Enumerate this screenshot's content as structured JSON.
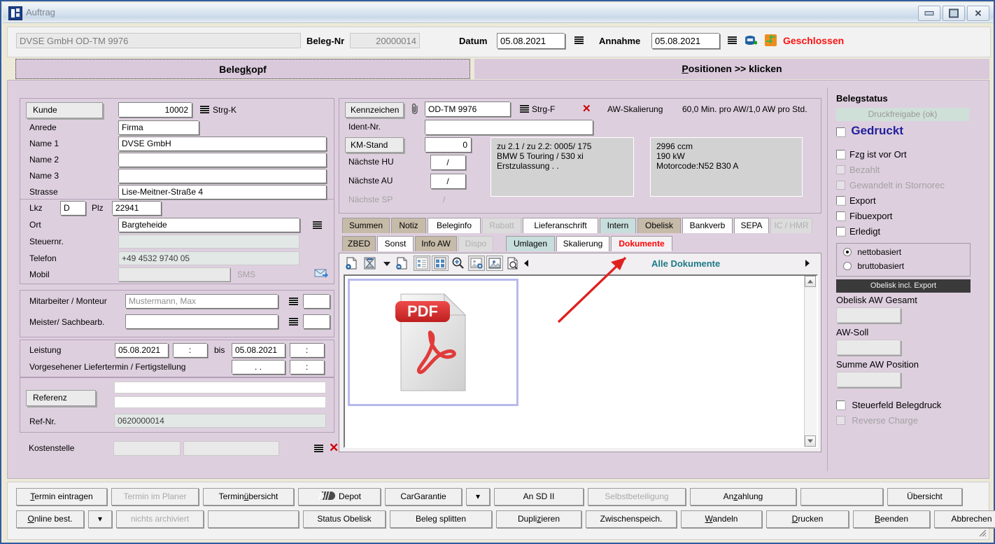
{
  "window": {
    "title": "Auftrag",
    "minimize": "–",
    "maximize": "□",
    "close": "✕"
  },
  "header": {
    "customer_vehicle": "DVSE GmbH OD-TM 9976",
    "beleg_nr_label": "Beleg-Nr",
    "beleg_nr_value": "20000014",
    "datum_label": "Datum",
    "datum_value": "05.08.2021",
    "annahme_label": "Annahme",
    "annahme_value": "05.08.2021",
    "status_text": "Geschlossen",
    "status_color": "#ff1111"
  },
  "main_tabs": [
    {
      "label": "Belegkopf",
      "accel": "k",
      "selected": true
    },
    {
      "label": "Positionen >> klicken",
      "accel": "P",
      "selected": false
    }
  ],
  "customer": {
    "kunde_label": "Kunde",
    "kunde_value": "10002",
    "kunde_shortcut": "Strg-K",
    "rows": [
      {
        "label": "Anrede",
        "value": "Firma"
      },
      {
        "label": "Name 1",
        "value": "DVSE GmbH"
      },
      {
        "label": "Name 2",
        "value": ""
      },
      {
        "label": "Name 3",
        "value": ""
      },
      {
        "label": "Strasse",
        "value": "Lise-Meitner-Straße 4"
      }
    ],
    "lkz_label": "Lkz",
    "lkz_value": "D",
    "plz_label": "Plz",
    "plz_value": "22941",
    "ort_label": "Ort",
    "ort_value": "Bargteheide",
    "steuernr_label": "Steuernr.",
    "steuernr_value": "",
    "telefon_label": "Telefon",
    "telefon_value": "+49 4532 9740 05",
    "mobil_label": "Mobil",
    "mobil_value": "",
    "sms_label": "SMS"
  },
  "staff": {
    "mitarbeiter_label": "Mitarbeiter / Monteur",
    "mitarbeiter_value": "Mustermann, Max",
    "meister_label": "Meister/ Sachbearb.",
    "meister_value": ""
  },
  "service": {
    "leistung_label": "Leistung",
    "leistung_from": "05.08.2021",
    "leistung_from_time": ":",
    "bis_label": "bis",
    "leistung_to": "05.08.2021",
    "leistung_to_time": ":",
    "liefertermin_label": "Vorgesehener Liefertermin / Fertigstellung",
    "liefertermin_date": ". .",
    "liefertermin_time": ":"
  },
  "reference": {
    "referenz_label": "Referenz",
    "referenz_line1": "",
    "referenz_line2": "",
    "refnr_label": "Ref-Nr.",
    "refnr_value": "0620000014"
  },
  "cost_center": {
    "label": "Kostenstelle",
    "value1": "",
    "value2": ""
  },
  "vehicle": {
    "kennzeichen_label": "Kennzeichen",
    "kennzeichen_value": "OD-TM 9976",
    "kennzeichen_shortcut": "Strg-F",
    "aw_skalierung_label": "AW-Skalierung",
    "aw_skalierung_value": "60,0 Min. pro AW/1,0 AW pro Std.",
    "ident_label": "Ident-Nr.",
    "ident_value": "",
    "km_label": "KM-Stand",
    "km_value": "0",
    "hu_label": "Nächste HU",
    "hu_value": "/",
    "au_label": "Nächste AU",
    "au_value": "/",
    "sp_label": "Nächste SP",
    "sp_value": "/",
    "info_left": [
      "zu 2.1 / zu 2.2: 0005/ 175",
      "BMW 5 Touring / 530 xi",
      "Erstzulassung  . ."
    ],
    "info_right": [
      "2996 ccm",
      "190 kW",
      "Motorcode:N52 B30 A"
    ]
  },
  "sub_tabs_row1": [
    {
      "label": "Summen",
      "style": "b"
    },
    {
      "label": "Notiz",
      "style": "b"
    },
    {
      "label": "Beleginfo",
      "style": "w"
    },
    {
      "label": "Rabatt",
      "style": "d"
    },
    {
      "label": "Lieferanschrift",
      "style": "w"
    },
    {
      "label": "Intern",
      "style": "t"
    },
    {
      "label": "Obelisk",
      "style": "b"
    },
    {
      "label": "Bankverb",
      "style": "w"
    },
    {
      "label": "SEPA",
      "style": "w"
    },
    {
      "label": "IC / HMR",
      "style": "d"
    }
  ],
  "sub_tabs_row2": [
    {
      "label": "ZBED",
      "style": "b"
    },
    {
      "label": "Sonst",
      "style": "w"
    },
    {
      "label": "Info AW",
      "style": "b"
    },
    {
      "label": "Dispo",
      "style": "d"
    },
    {
      "label": "Umlagen",
      "style": "t"
    },
    {
      "label": "Skalierung",
      "style": "w"
    },
    {
      "label": "Dokumente",
      "style": "act"
    }
  ],
  "documents": {
    "toolbar_icons": [
      "add-document-icon",
      "scan-icon",
      "scan-dropdown-icon",
      "remove-document-icon",
      "list-view-icon",
      "grid-view-icon",
      "zoom-icon",
      "add-image-icon",
      "image-icon",
      "preview-icon",
      "prev-arrow-icon"
    ],
    "filter_label": "Alle Dokumente",
    "next_arrow": "next-arrow-icon",
    "thumbnail_type": "PDF",
    "pdf_badge": "PDF"
  },
  "status_panel": {
    "title": "Belegstatus",
    "druckfreigabe": "Druckfreigabe (ok)",
    "gedruckt_label": "Gedruckt",
    "gedruckt_color": "#1f1f9a",
    "gedruckt_checked": false,
    "checkboxes": [
      {
        "label": "Fzg ist vor Ort",
        "checked": false,
        "disabled": false
      },
      {
        "label": "Bezahlt",
        "checked": false,
        "disabled": true
      },
      {
        "label": "Gewandelt in Stornorec",
        "checked": false,
        "disabled": true
      },
      {
        "label": "Export",
        "checked": false,
        "disabled": false
      },
      {
        "label": "Fibuexport",
        "checked": false,
        "disabled": false
      },
      {
        "label": "Erledigt",
        "checked": false,
        "disabled": false
      }
    ],
    "radios": [
      {
        "label": "nettobasiert",
        "selected": true
      },
      {
        "label": "bruttobasiert",
        "selected": false
      }
    ],
    "obelisk_button": "Obelisk incl. Export",
    "fields": [
      {
        "label": "Obelisk AW Gesamt",
        "value": ""
      },
      {
        "label": "AW-Soll",
        "value": ""
      },
      {
        "label": "Summe AW Position",
        "value": ""
      }
    ],
    "bottom_checkboxes": [
      {
        "label": "Steuerfeld Belegdruck",
        "checked": false,
        "disabled": false
      },
      {
        "label": "Reverse Charge",
        "checked": false,
        "disabled": true
      }
    ]
  },
  "bottom_buttons_row1": [
    {
      "label": "Termin eintragen",
      "accel": "T",
      "disabled": false,
      "width": 130
    },
    {
      "label": "Termin im Planer",
      "accel": "",
      "disabled": true,
      "width": 125
    },
    {
      "label": "Terminübersicht",
      "accel": "ü",
      "disabled": false,
      "width": 130
    },
    {
      "label": "Depot",
      "accel": "",
      "disabled": false,
      "width": 118,
      "icon": "tire-icon"
    },
    {
      "label": "CarGarantie",
      "accel": "",
      "disabled": false,
      "width": 110
    },
    {
      "label": "▾",
      "accel": "",
      "disabled": false,
      "width": 34
    },
    {
      "label": "An SD II",
      "accel": "",
      "disabled": false,
      "width": 128
    },
    {
      "label": "Selbstbeteiligung",
      "accel": "",
      "disabled": true,
      "width": 140
    },
    {
      "label": "Anzahlung",
      "accel": "z",
      "disabled": false,
      "width": 152
    },
    {
      "label": "",
      "accel": "",
      "disabled": false,
      "width": 118
    },
    {
      "label": "Übersicht",
      "accel": "",
      "disabled": false,
      "width": 107
    }
  ],
  "bottom_buttons_row2": [
    {
      "label": "Online best.",
      "accel": "O",
      "disabled": false,
      "width": 97
    },
    {
      "label": "▾",
      "accel": "",
      "disabled": false,
      "width": 34
    },
    {
      "label": "nichts archiviert",
      "accel": "",
      "disabled": true,
      "width": 125
    },
    {
      "label": "",
      "accel": "",
      "disabled": false,
      "width": 130
    },
    {
      "label": "Status Obelisk",
      "accel": "",
      "disabled": false,
      "width": 118
    },
    {
      "label": "Beleg splitten",
      "accel": "",
      "disabled": false,
      "width": 146
    },
    {
      "label": "Duplizieren",
      "accel": "z",
      "disabled": false,
      "width": 122
    },
    {
      "label": "Zwischenspeich.",
      "accel": "",
      "disabled": false,
      "width": 130
    },
    {
      "label": "Wandeln",
      "accel": "W",
      "disabled": false,
      "width": 116
    },
    {
      "label": "Drucken",
      "accel": "D",
      "disabled": false,
      "width": 118
    },
    {
      "label": "Beenden",
      "accel": "B",
      "disabled": false,
      "width": 110
    },
    {
      "label": "Abbrechen",
      "accel": "",
      "disabled": false,
      "width": 107
    }
  ]
}
